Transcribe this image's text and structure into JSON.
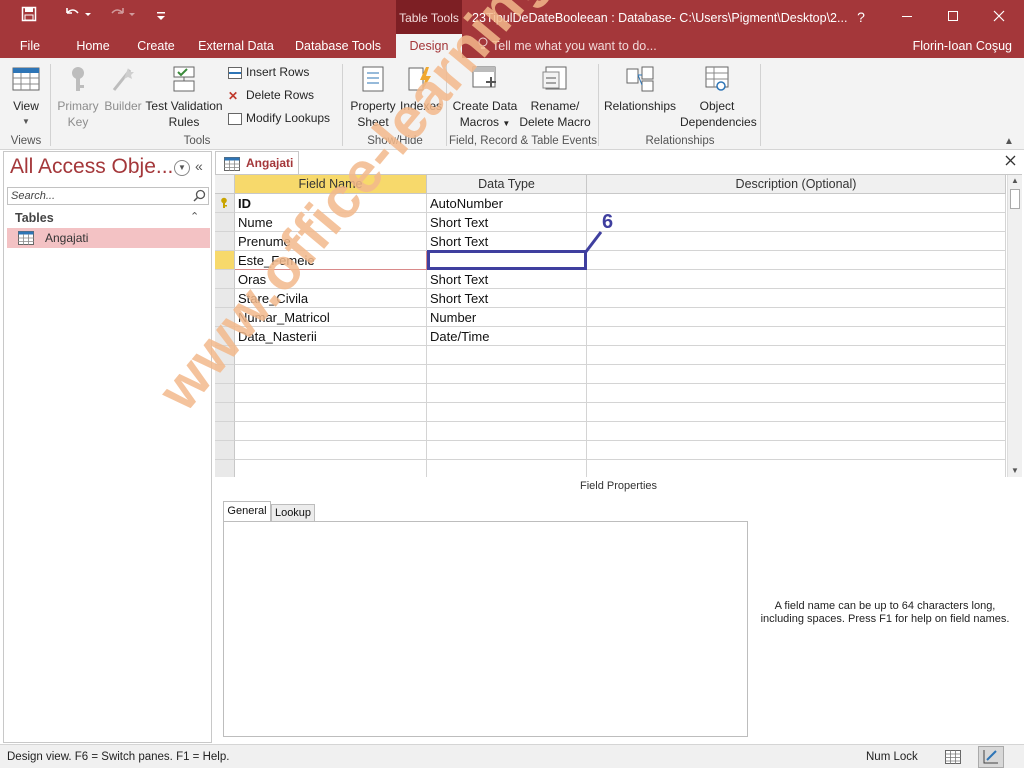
{
  "titlebar": {
    "context_tab": "Table Tools",
    "title": "23TipulDeDateBooleean : Database- C:\\Users\\Pigment\\Desktop\\2...",
    "help": "?"
  },
  "ribbon_tabs": [
    "File",
    "Home",
    "Create",
    "External Data",
    "Database Tools",
    "Design"
  ],
  "tellme": "Tell me what you want to do...",
  "user": "Florin-Ioan Coşug",
  "ribbon": {
    "view": "View",
    "primary_key": [
      "Primary",
      "Key"
    ],
    "builder": "Builder",
    "test_validation": [
      "Test Validation",
      "Rules"
    ],
    "insert_rows": "Insert Rows",
    "delete_rows": "Delete Rows",
    "modify_lookups": "Modify Lookups",
    "property_sheet": [
      "Property",
      "Sheet"
    ],
    "indexes": "Indexes",
    "create_data_macros": [
      "Create Data",
      "Macros"
    ],
    "rename_delete_macro": [
      "Rename/",
      "Delete Macro"
    ],
    "relationships": "Relationships",
    "object_dependencies": [
      "Object",
      "Dependencies"
    ],
    "groups": {
      "views": "Views",
      "tools": "Tools",
      "show_hide": "Show/Hide",
      "field_record_events": "Field, Record & Table Events",
      "relationships": "Relationships"
    }
  },
  "nav": {
    "title": "All Access Obje...",
    "search_placeholder": "Search...",
    "group": "Tables",
    "items": [
      "Angajati"
    ]
  },
  "document": {
    "tab": "Angajati",
    "headers": [
      "Field Name",
      "Data Type",
      "Description (Optional)"
    ],
    "rows": [
      {
        "name": "ID",
        "type": "AutoNumber",
        "desc": ""
      },
      {
        "name": "Nume",
        "type": "Short Text",
        "desc": ""
      },
      {
        "name": "Prenume",
        "type": "Short Text",
        "desc": ""
      },
      {
        "name": "Este_Femeie",
        "type": "",
        "desc": ""
      },
      {
        "name": "Oras",
        "type": "Short Text",
        "desc": ""
      },
      {
        "name": "Stare_Civila",
        "type": "Short Text",
        "desc": ""
      },
      {
        "name": "Numar_Matricol",
        "type": "Number",
        "desc": ""
      },
      {
        "name": "Data_Nasterii",
        "type": "Date/Time",
        "desc": ""
      }
    ],
    "annotation": "6",
    "field_properties_label": "Field Properties",
    "prop_tabs": [
      "General",
      "Lookup"
    ],
    "help_text": "A field name can be up to 64 characters long, including spaces. Press F1 for help on field names."
  },
  "status": {
    "text": "Design view.  F6 = Switch panes.  F1 = Help.",
    "numlock": "Num Lock"
  },
  "watermark": "www.office-learning.ro",
  "colors": {
    "accent": "#a4373a",
    "highlight": "#3f3f9f",
    "selected_nav": "#f3c2c4"
  }
}
